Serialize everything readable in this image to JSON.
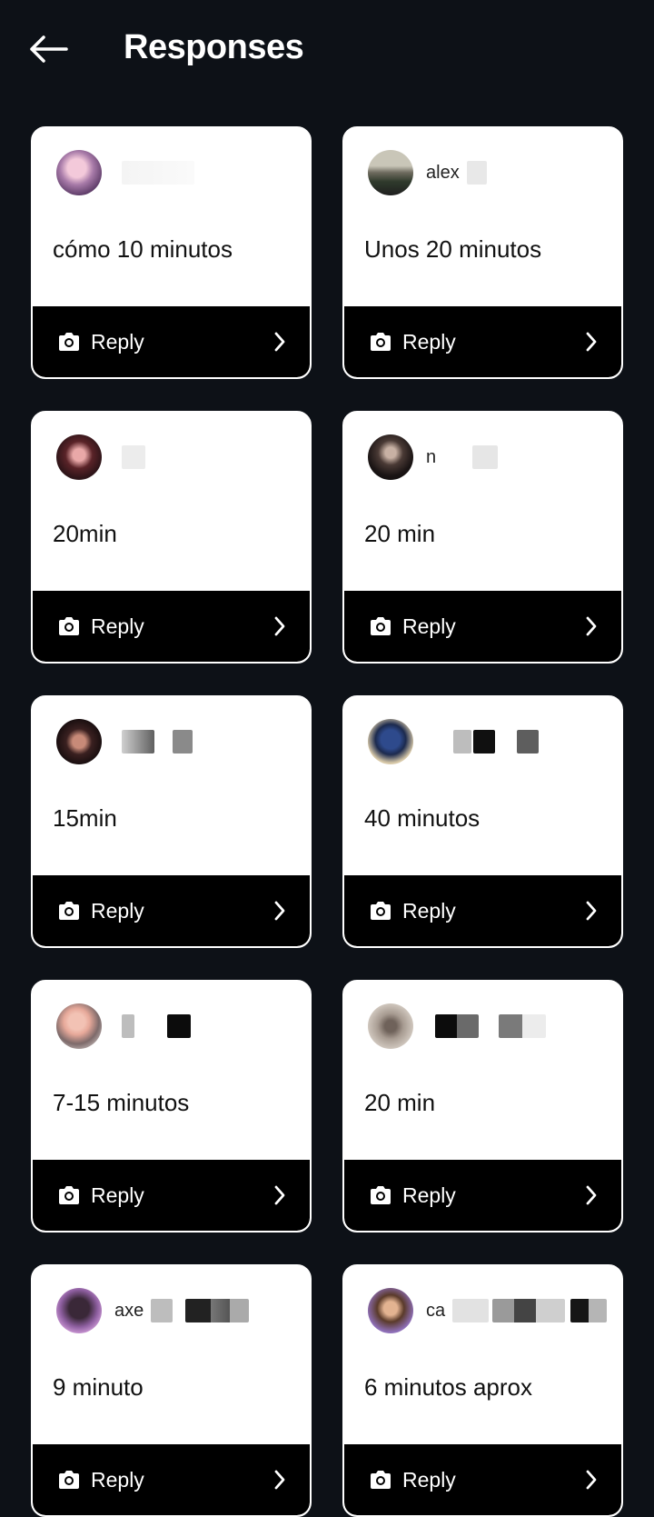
{
  "header": {
    "title": "Responses",
    "back_icon": "arrow-left-icon"
  },
  "colors": {
    "background": "#0d1117",
    "card": "#ffffff",
    "reply_bar": "#000000"
  },
  "responses": [
    {
      "username": "",
      "answer": "cómo 10 minutos",
      "reply_label": "Reply"
    },
    {
      "username": "alex",
      "answer": "Unos 20 minutos",
      "reply_label": "Reply"
    },
    {
      "username": "",
      "answer": "20min",
      "reply_label": "Reply"
    },
    {
      "username": "n",
      "answer": "20 min",
      "reply_label": "Reply"
    },
    {
      "username": "",
      "answer": "15min",
      "reply_label": "Reply"
    },
    {
      "username": "",
      "answer": "40 minutos",
      "reply_label": "Reply"
    },
    {
      "username": "",
      "answer": "7-15 minutos",
      "reply_label": "Reply"
    },
    {
      "username": "",
      "answer": "20 min",
      "reply_label": "Reply"
    },
    {
      "username": "axe",
      "answer": "9 minuto",
      "reply_label": "Reply"
    },
    {
      "username": "ca",
      "answer": "6 minutos aprox",
      "reply_label": "Reply"
    }
  ],
  "icons": {
    "camera": "camera-icon",
    "chevron": "chevron-right-icon"
  }
}
